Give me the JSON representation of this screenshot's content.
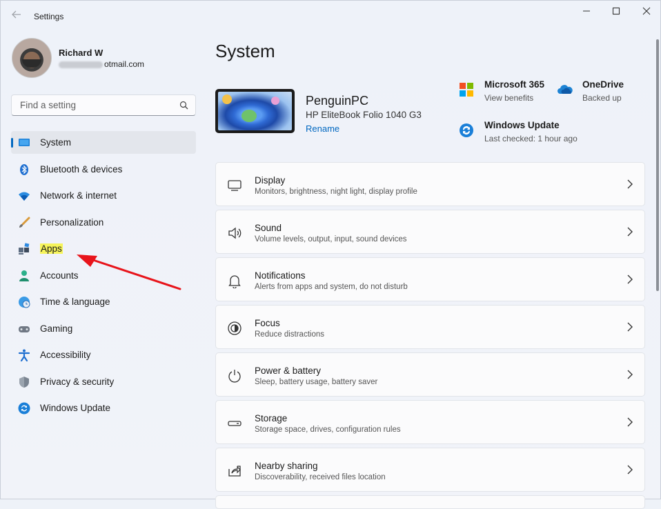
{
  "window": {
    "title": "Settings",
    "back_icon": "back-arrow-icon",
    "controls": [
      "minimize-icon",
      "maximize-icon",
      "close-icon"
    ]
  },
  "profile": {
    "name": "Richard W",
    "email_visible_suffix": "otmail.com"
  },
  "search": {
    "placeholder": "Find a setting",
    "icon": "search-icon"
  },
  "nav": {
    "items": [
      {
        "label": "System",
        "icon": "system-icon",
        "active": true
      },
      {
        "label": "Bluetooth & devices",
        "icon": "bluetooth-icon"
      },
      {
        "label": "Network & internet",
        "icon": "wifi-icon"
      },
      {
        "label": "Personalization",
        "icon": "brush-icon"
      },
      {
        "label": "Apps",
        "icon": "apps-icon",
        "highlighted": true
      },
      {
        "label": "Accounts",
        "icon": "person-icon"
      },
      {
        "label": "Time & language",
        "icon": "clock-globe-icon"
      },
      {
        "label": "Gaming",
        "icon": "gamepad-icon"
      },
      {
        "label": "Accessibility",
        "icon": "accessibility-icon"
      },
      {
        "label": "Privacy & security",
        "icon": "shield-icon"
      },
      {
        "label": "Windows Update",
        "icon": "update-icon"
      }
    ]
  },
  "main": {
    "title": "System",
    "device": {
      "name": "PenguinPC",
      "model": "HP EliteBook Folio 1040 G3",
      "rename": "Rename"
    },
    "quick_links": [
      {
        "title": "Microsoft 365",
        "sub": "View benefits",
        "icon": "microsoft-365-icon"
      },
      {
        "title": "OneDrive",
        "sub": "Backed up",
        "icon": "onedrive-cloud-icon"
      },
      {
        "title": "Windows Update",
        "sub": "Last checked: 1 hour ago",
        "icon": "windows-update-icon"
      }
    ],
    "cards": [
      {
        "title": "Display",
        "sub": "Monitors, brightness, night light, display profile",
        "icon": "display-icon"
      },
      {
        "title": "Sound",
        "sub": "Volume levels, output, input, sound devices",
        "icon": "speaker-icon"
      },
      {
        "title": "Notifications",
        "sub": "Alerts from apps and system, do not disturb",
        "icon": "bell-icon"
      },
      {
        "title": "Focus",
        "sub": "Reduce distractions",
        "icon": "focus-icon"
      },
      {
        "title": "Power & battery",
        "sub": "Sleep, battery usage, battery saver",
        "icon": "power-icon"
      },
      {
        "title": "Storage",
        "sub": "Storage space, drives, configuration rules",
        "icon": "storage-icon"
      },
      {
        "title": "Nearby sharing",
        "sub": "Discoverability, received files location",
        "icon": "share-icon"
      }
    ]
  },
  "colors": {
    "accent": "#0067c0",
    "highlight": "#f6f45a",
    "annotation_arrow": "#e8141b"
  }
}
